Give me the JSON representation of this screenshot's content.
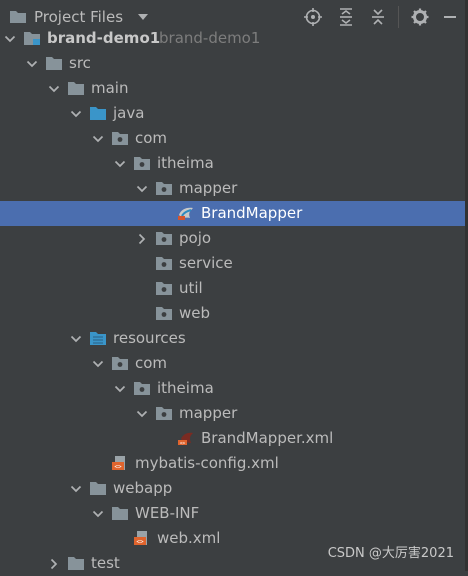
{
  "header": {
    "title": "Project Files",
    "folder_icon": "folder-icon",
    "dropdown_icon": "chevron-down-icon",
    "buttons": [
      "locate-icon",
      "expand-all-icon",
      "collapse-all-icon",
      "gear-icon",
      "hide-icon"
    ]
  },
  "tree": [
    {
      "label": "brand-demo1",
      "hint": "brand-demo1",
      "depth": 0,
      "expanded": true,
      "icon": "module-folder-icon"
    },
    {
      "label": "src",
      "depth": 1,
      "expanded": true,
      "icon": "folder-icon"
    },
    {
      "label": "main",
      "depth": 2,
      "expanded": true,
      "icon": "folder-icon"
    },
    {
      "label": "java",
      "depth": 3,
      "expanded": true,
      "icon": "source-folder-icon"
    },
    {
      "label": "com",
      "depth": 4,
      "expanded": true,
      "icon": "package-icon"
    },
    {
      "label": "itheima",
      "depth": 5,
      "expanded": true,
      "icon": "package-icon"
    },
    {
      "label": "mapper",
      "depth": 6,
      "expanded": true,
      "icon": "package-icon"
    },
    {
      "label": "BrandMapper",
      "depth": 7,
      "expanded": null,
      "icon": "mybatis-mapper-icon",
      "selected": true
    },
    {
      "label": "pojo",
      "depth": 6,
      "expanded": false,
      "icon": "package-icon"
    },
    {
      "label": "service",
      "depth": 6,
      "expanded": null,
      "icon": "package-icon"
    },
    {
      "label": "util",
      "depth": 6,
      "expanded": null,
      "icon": "package-icon"
    },
    {
      "label": "web",
      "depth": 6,
      "expanded": null,
      "icon": "package-icon"
    },
    {
      "label": "resources",
      "depth": 3,
      "expanded": true,
      "icon": "resources-folder-icon"
    },
    {
      "label": "com",
      "depth": 4,
      "expanded": true,
      "icon": "package-icon"
    },
    {
      "label": "itheima",
      "depth": 5,
      "expanded": true,
      "icon": "package-icon"
    },
    {
      "label": "mapper",
      "depth": 6,
      "expanded": true,
      "icon": "package-icon"
    },
    {
      "label": "BrandMapper.xml",
      "depth": 7,
      "expanded": null,
      "icon": "mybatis-xml-icon"
    },
    {
      "label": "mybatis-config.xml",
      "depth": 4,
      "expanded": null,
      "icon": "xml-file-icon"
    },
    {
      "label": "webapp",
      "depth": 3,
      "expanded": true,
      "icon": "folder-icon"
    },
    {
      "label": "WEB-INF",
      "depth": 4,
      "expanded": true,
      "icon": "folder-icon"
    },
    {
      "label": "web.xml",
      "depth": 5,
      "expanded": null,
      "icon": "xml-file-icon"
    },
    {
      "label": "test",
      "depth": 2,
      "expanded": false,
      "icon": "folder-icon"
    }
  ],
  "watermark": "CSDN @大厉害2021",
  "colors": {
    "background": "#3c3f41",
    "selection": "#4b6eaf",
    "text": "#bbbbbb",
    "folder": "#87939a",
    "source_folder": "#3a95c9",
    "xml": "#e0642d"
  }
}
